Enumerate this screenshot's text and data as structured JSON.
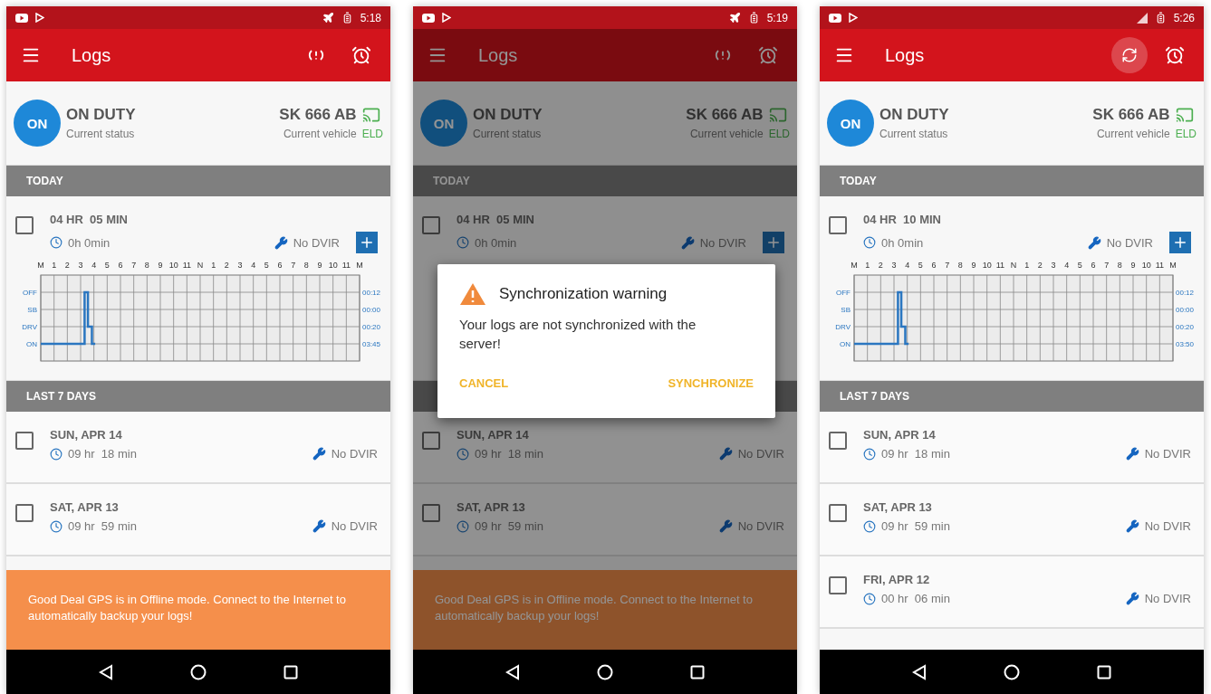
{
  "phones": [
    {
      "status_bar": {
        "time": "5:18",
        "airplane_mode": true
      },
      "app_bar": {
        "title": "Logs",
        "sync_pressed": false
      },
      "duty": {
        "badge": "ON",
        "title": "ON DUTY",
        "subtitle": "Current status"
      },
      "vehicle": {
        "plate": "SK 666 AB",
        "subtitle": "Current vehicle",
        "eld": "ELD"
      },
      "today_label": "TODAY",
      "today": {
        "title": "04 HR  05 MIN",
        "duration": "0h 0min",
        "dvir": "No DVIR",
        "checked": false,
        "graph": {
          "hour_labels": [
            "M",
            "1",
            "2",
            "3",
            "4",
            "5",
            "6",
            "7",
            "8",
            "9",
            "10",
            "11",
            "N",
            "1",
            "2",
            "3",
            "4",
            "5",
            "6",
            "7",
            "8",
            "9",
            "10",
            "11",
            "M"
          ],
          "status_labels": [
            "OFF",
            "SB",
            "DRV",
            "ON"
          ],
          "totals": [
            "00:12",
            "00:00",
            "00:20",
            "03:45"
          ]
        }
      },
      "days_label": "LAST 7 DAYS",
      "days": [
        {
          "date": "SUN, APR 14",
          "duration": "09 hr  18 min",
          "dvir": "No DVIR",
          "checked": false
        },
        {
          "date": "SAT, APR 13",
          "duration": "09 hr  59 min",
          "dvir": "No DVIR",
          "checked": false
        }
      ],
      "banner": "Good Deal GPS is in Offline mode. Connect to the Internet to automatically backup your logs!"
    },
    {
      "status_bar": {
        "time": "5:19",
        "airplane_mode": true
      },
      "app_bar": {
        "title": "Logs",
        "sync_pressed": false
      },
      "duty": {
        "badge": "ON",
        "title": "ON DUTY",
        "subtitle": "Current status"
      },
      "vehicle": {
        "plate": "SK 666 AB",
        "subtitle": "Current vehicle",
        "eld": "ELD"
      },
      "today_label": "TODAY",
      "today": {
        "title": "04 HR  05 MIN",
        "duration": "0h 0min",
        "dvir": "No DVIR",
        "checked": false
      },
      "days": [
        {
          "date": "SUN, APR 14",
          "duration": "09 hr  18 min",
          "dvir": "No DVIR",
          "checked": false
        },
        {
          "date": "SAT, APR 13",
          "duration": "09 hr  59 min",
          "dvir": "No DVIR",
          "checked": false
        }
      ],
      "banner": "Good Deal GPS is in Offline mode. Connect to the Internet to automatically backup your logs!",
      "dialog": {
        "title": "Synchronization warning",
        "message": "Your logs are not synchronized with the server!",
        "buttons": [
          "CANCEL",
          "SYNCHRONIZE"
        ]
      }
    },
    {
      "status_bar": {
        "time": "5:26",
        "airplane_mode": false
      },
      "app_bar": {
        "title": "Logs",
        "sync_pressed": true
      },
      "duty": {
        "badge": "ON",
        "title": "ON DUTY",
        "subtitle": "Current status"
      },
      "vehicle": {
        "plate": "SK 666 AB",
        "subtitle": "Current vehicle",
        "eld": "ELD"
      },
      "today_label": "TODAY",
      "today": {
        "title": "04 HR  10 MIN",
        "duration": "0h 0min",
        "dvir": "No DVIR",
        "checked": false,
        "graph": {
          "hour_labels": [
            "M",
            "1",
            "2",
            "3",
            "4",
            "5",
            "6",
            "7",
            "8",
            "9",
            "10",
            "11",
            "N",
            "1",
            "2",
            "3",
            "4",
            "5",
            "6",
            "7",
            "8",
            "9",
            "10",
            "11",
            "M"
          ],
          "status_labels": [
            "OFF",
            "SB",
            "DRV",
            "ON"
          ],
          "totals": [
            "00:12",
            "00:00",
            "00:20",
            "03:50"
          ]
        }
      },
      "days_label": "LAST 7 DAYS",
      "days": [
        {
          "date": "SUN, APR 14",
          "duration": "09 hr  18 min",
          "dvir": "No DVIR",
          "checked": false
        },
        {
          "date": "SAT, APR 13",
          "duration": "09 hr  59 min",
          "dvir": "No DVIR",
          "checked": false
        },
        {
          "date": "FRI, APR 12",
          "duration": "00 hr  06 min",
          "dvir": "No DVIR",
          "checked": false
        }
      ]
    }
  ]
}
